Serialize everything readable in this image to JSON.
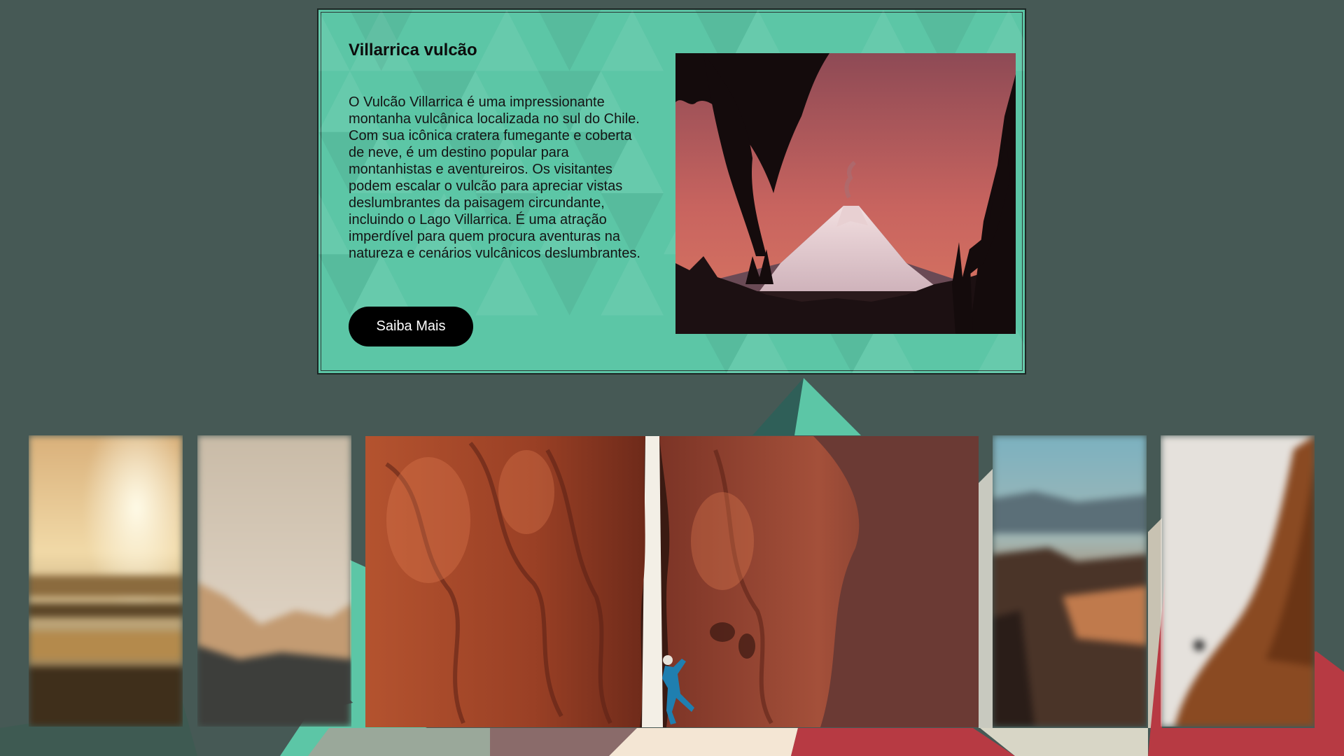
{
  "card": {
    "title": "Villarrica vulcão",
    "description": "O Vulcão Villarrica é uma impressionante montanha vulcânica localizada no sul do Chile. Com sua icônica cratera fumegante e coberta de neve, é um destino popular para montanhistas e aventureiros. Os visitantes podem escalar o vulcão para apreciar vistas deslumbrantes da paisagem circundante, incluindo o Lago Villarrica. É uma atração imperdível para quem procura aventuras na natureza e cenários vulcânicos deslumbrantes.",
    "button_label": "Saiba Mais"
  },
  "gallery": {
    "items": [
      {
        "subject": "sunset over sea (blurred)"
      },
      {
        "subject": "misty mountains (blurred)"
      },
      {
        "subject": "climber in red rock canyon",
        "active": true
      },
      {
        "subject": "cliffs at dusk (blurred)"
      },
      {
        "subject": "climber on rock face (blurred)"
      }
    ]
  },
  "colors": {
    "page_background": "#465955",
    "card_background": "#5cc6a6",
    "button_background": "#000000",
    "button_text": "#ffffff",
    "accent_red": "#b73a43",
    "accent_cream": "#f4e6d4"
  }
}
